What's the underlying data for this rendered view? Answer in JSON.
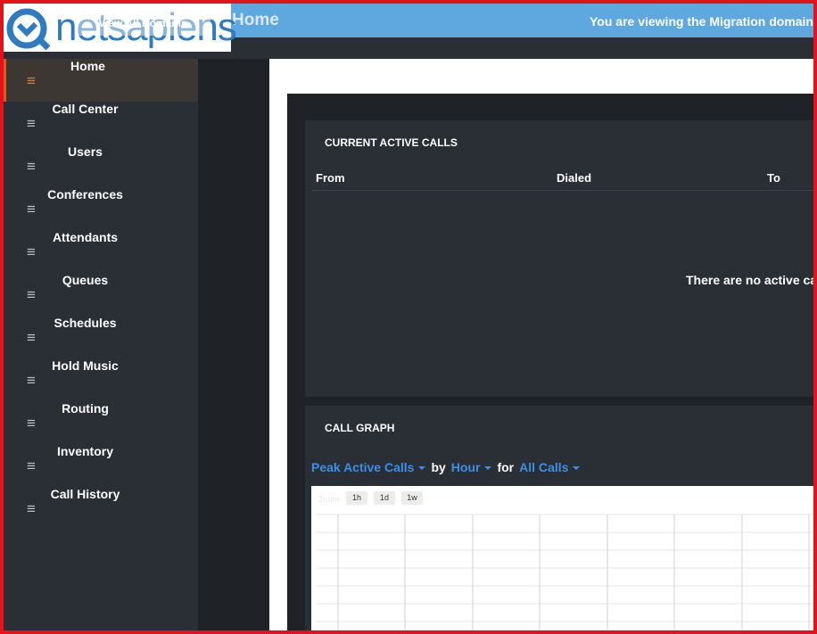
{
  "header": {
    "logo_text": "netsapiens",
    "view_all_domains": "View All Domains",
    "page_title": "Home",
    "domain_notice": "You are viewing the Migration domain fo"
  },
  "sidebar": {
    "items": [
      {
        "label": "Home",
        "active": true
      },
      {
        "label": "Call Center"
      },
      {
        "label": "Users"
      },
      {
        "label": "Conferences"
      },
      {
        "label": "Attendants"
      },
      {
        "label": "Queues"
      },
      {
        "label": "Schedules"
      },
      {
        "label": "Hold Music"
      },
      {
        "label": "Routing"
      },
      {
        "label": "Inventory"
      },
      {
        "label": "Call History"
      }
    ],
    "icon": "hamburger-icon"
  },
  "active_calls": {
    "title": "CURRENT ACTIVE CALLS",
    "columns": [
      "From",
      "Dialed",
      "To"
    ],
    "empty_message": "There are no active cal"
  },
  "call_graph": {
    "title": "CALL GRAPH",
    "metric": "Peak Active Calls",
    "by_label": "by",
    "interval": "Hour",
    "for_label": "for",
    "filter": "All Calls",
    "zoom_label": "Zoom",
    "zoom_buttons": [
      "1h",
      "1d",
      "1w"
    ]
  },
  "colors": {
    "topbar": "#5fa8df",
    "sidebar": "#2a2e35",
    "accent": "#e4541b",
    "link": "#3c8fe6",
    "frame": "#e3121b"
  }
}
